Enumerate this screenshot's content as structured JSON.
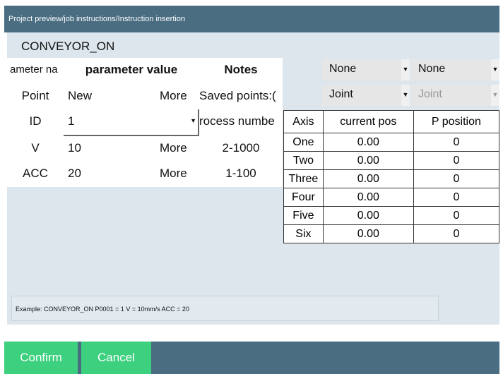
{
  "window": {
    "title": "Project preview/job instructions/Instruction insertion"
  },
  "instruction": {
    "name": "CONVEYOR_ON"
  },
  "params": {
    "headers": {
      "name": "ameter na",
      "value": "parameter value",
      "notes": "Notes"
    },
    "point": {
      "label": "Point",
      "value": "New",
      "more": "More",
      "note": "Saved points:("
    },
    "id": {
      "label": "ID",
      "value": "1",
      "note": "rocess numbe"
    },
    "v": {
      "label": "V",
      "value": "10",
      "more": "More",
      "note": "2-1000"
    },
    "acc": {
      "label": "ACC",
      "value": "20",
      "more": "More",
      "note": "1-100"
    }
  },
  "selects": {
    "sel1": "None",
    "sel2": "None",
    "sel3": "Joint",
    "sel4": "Joint"
  },
  "axis_table": {
    "headers": [
      "Axis",
      "current pos",
      "P position"
    ],
    "rows": [
      [
        "One",
        "0.00",
        "0"
      ],
      [
        "Two",
        "0.00",
        "0"
      ],
      [
        "Three",
        "0.00",
        "0"
      ],
      [
        "Four",
        "0.00",
        "0"
      ],
      [
        "Five",
        "0.00",
        "0"
      ],
      [
        "Six",
        "0.00",
        "0"
      ]
    ]
  },
  "example": "Example: CONVEYOR_ON P0001 = 1 V = 10mm/s ACC = 20",
  "buttons": {
    "confirm": "Confirm",
    "cancel": "Cancel"
  },
  "colors": {
    "header": "#4a6d82",
    "panel": "#dde6ec",
    "button": "#3dd07f"
  }
}
